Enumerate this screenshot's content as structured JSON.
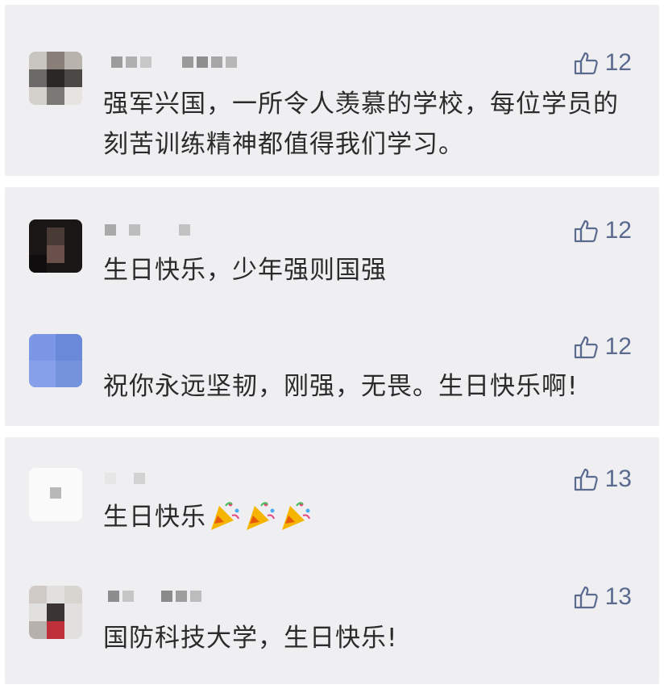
{
  "cards": [
    {
      "comments": [
        {
          "likes": "12",
          "text": "强军兴国，一所令人羡慕的学校，每位学员的刻苦训练精神都值得我们学习。"
        }
      ]
    },
    {
      "comments": [
        {
          "likes": "12",
          "text": "生日快乐，少年强则国强"
        },
        {
          "likes": "12",
          "text": "祝你永远坚韧，刚强，无畏。生日快乐啊!"
        }
      ]
    },
    {
      "comments": [
        {
          "likes": "13",
          "text": "生日快乐",
          "emoji": "party-popper-icon",
          "emoji_count": 3
        },
        {
          "likes": "13",
          "text": "国防科技大学，生日快乐!"
        }
      ]
    }
  ],
  "colors": {
    "card_bg": "#efeff1",
    "text": "#2b2b2b",
    "like": "#5b6a8f"
  }
}
